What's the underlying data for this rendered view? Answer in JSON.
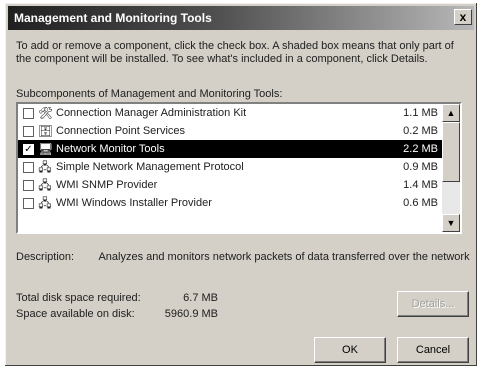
{
  "window": {
    "title": "Management and Monitoring Tools",
    "close_glyph": "x"
  },
  "description": "To add or remove a component, click the check box. A shaded box means that only part of the component will be installed. To see what's included in a component, click Details.",
  "subcomponents_label": "Subcomponents of Management and Monitoring Tools:",
  "components": [
    {
      "name": "Connection Manager Administration Kit",
      "size": "1.1 MB",
      "checked": false,
      "selected": false,
      "icon": "admin-kit-icon"
    },
    {
      "name": "Connection Point Services",
      "size": "0.2 MB",
      "checked": false,
      "selected": false,
      "icon": "services-icon"
    },
    {
      "name": "Network Monitor Tools",
      "size": "2.2 MB",
      "checked": true,
      "selected": true,
      "icon": "network-monitor-icon"
    },
    {
      "name": "Simple Network Management Protocol",
      "size": "0.9 MB",
      "checked": false,
      "selected": false,
      "icon": "snmp-icon"
    },
    {
      "name": "WMI SNMP Provider",
      "size": "1.4 MB",
      "checked": false,
      "selected": false,
      "icon": "wmi-provider-icon"
    },
    {
      "name": "WMI Windows Installer Provider",
      "size": "0.6 MB",
      "checked": false,
      "selected": false,
      "icon": "wmi-installer-icon"
    }
  ],
  "description_label": "Description:",
  "description_text": "Analyzes and monitors network packets of data transferred over the network",
  "space": {
    "required_label": "Total disk space required:",
    "required_value": "6.7 MB",
    "available_label": "Space available on disk:",
    "available_value": "5960.9 MB"
  },
  "buttons": {
    "details": "Details...",
    "ok": "OK",
    "cancel": "Cancel"
  }
}
